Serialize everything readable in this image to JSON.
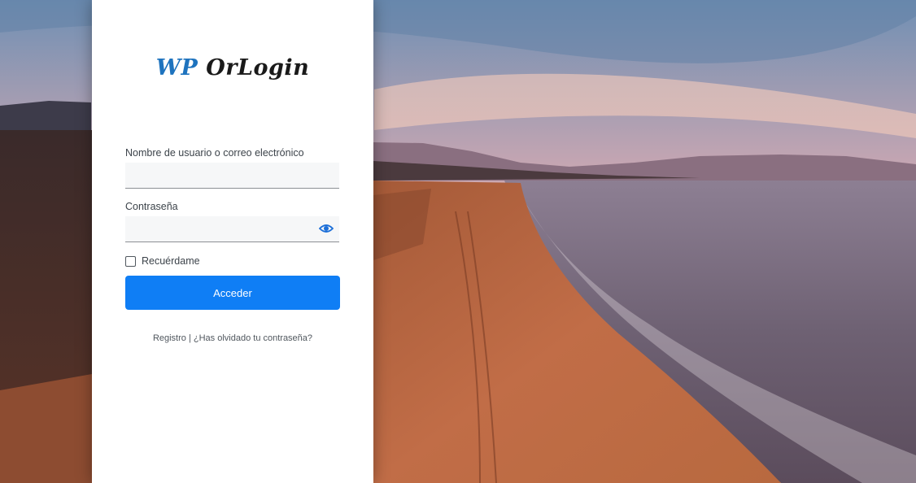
{
  "logo": {
    "prefix": "WP",
    "name": "OrLogin"
  },
  "form": {
    "username_label": "Nombre de usuario o correo electrónico",
    "username_value": "",
    "password_label": "Contraseña",
    "password_value": "",
    "remember_label": "Recuérdame",
    "remember_checked": false,
    "submit_label": "Acceder"
  },
  "links": {
    "register": "Registro",
    "separator": "|",
    "forgot": "¿Has olvidado tu contraseña?"
  },
  "icons": {
    "password_toggle": "eye-icon"
  },
  "colors": {
    "accent": "#0f7ef5",
    "logo_prefix": "#1e73be",
    "logo_name": "#1a1a1a"
  }
}
